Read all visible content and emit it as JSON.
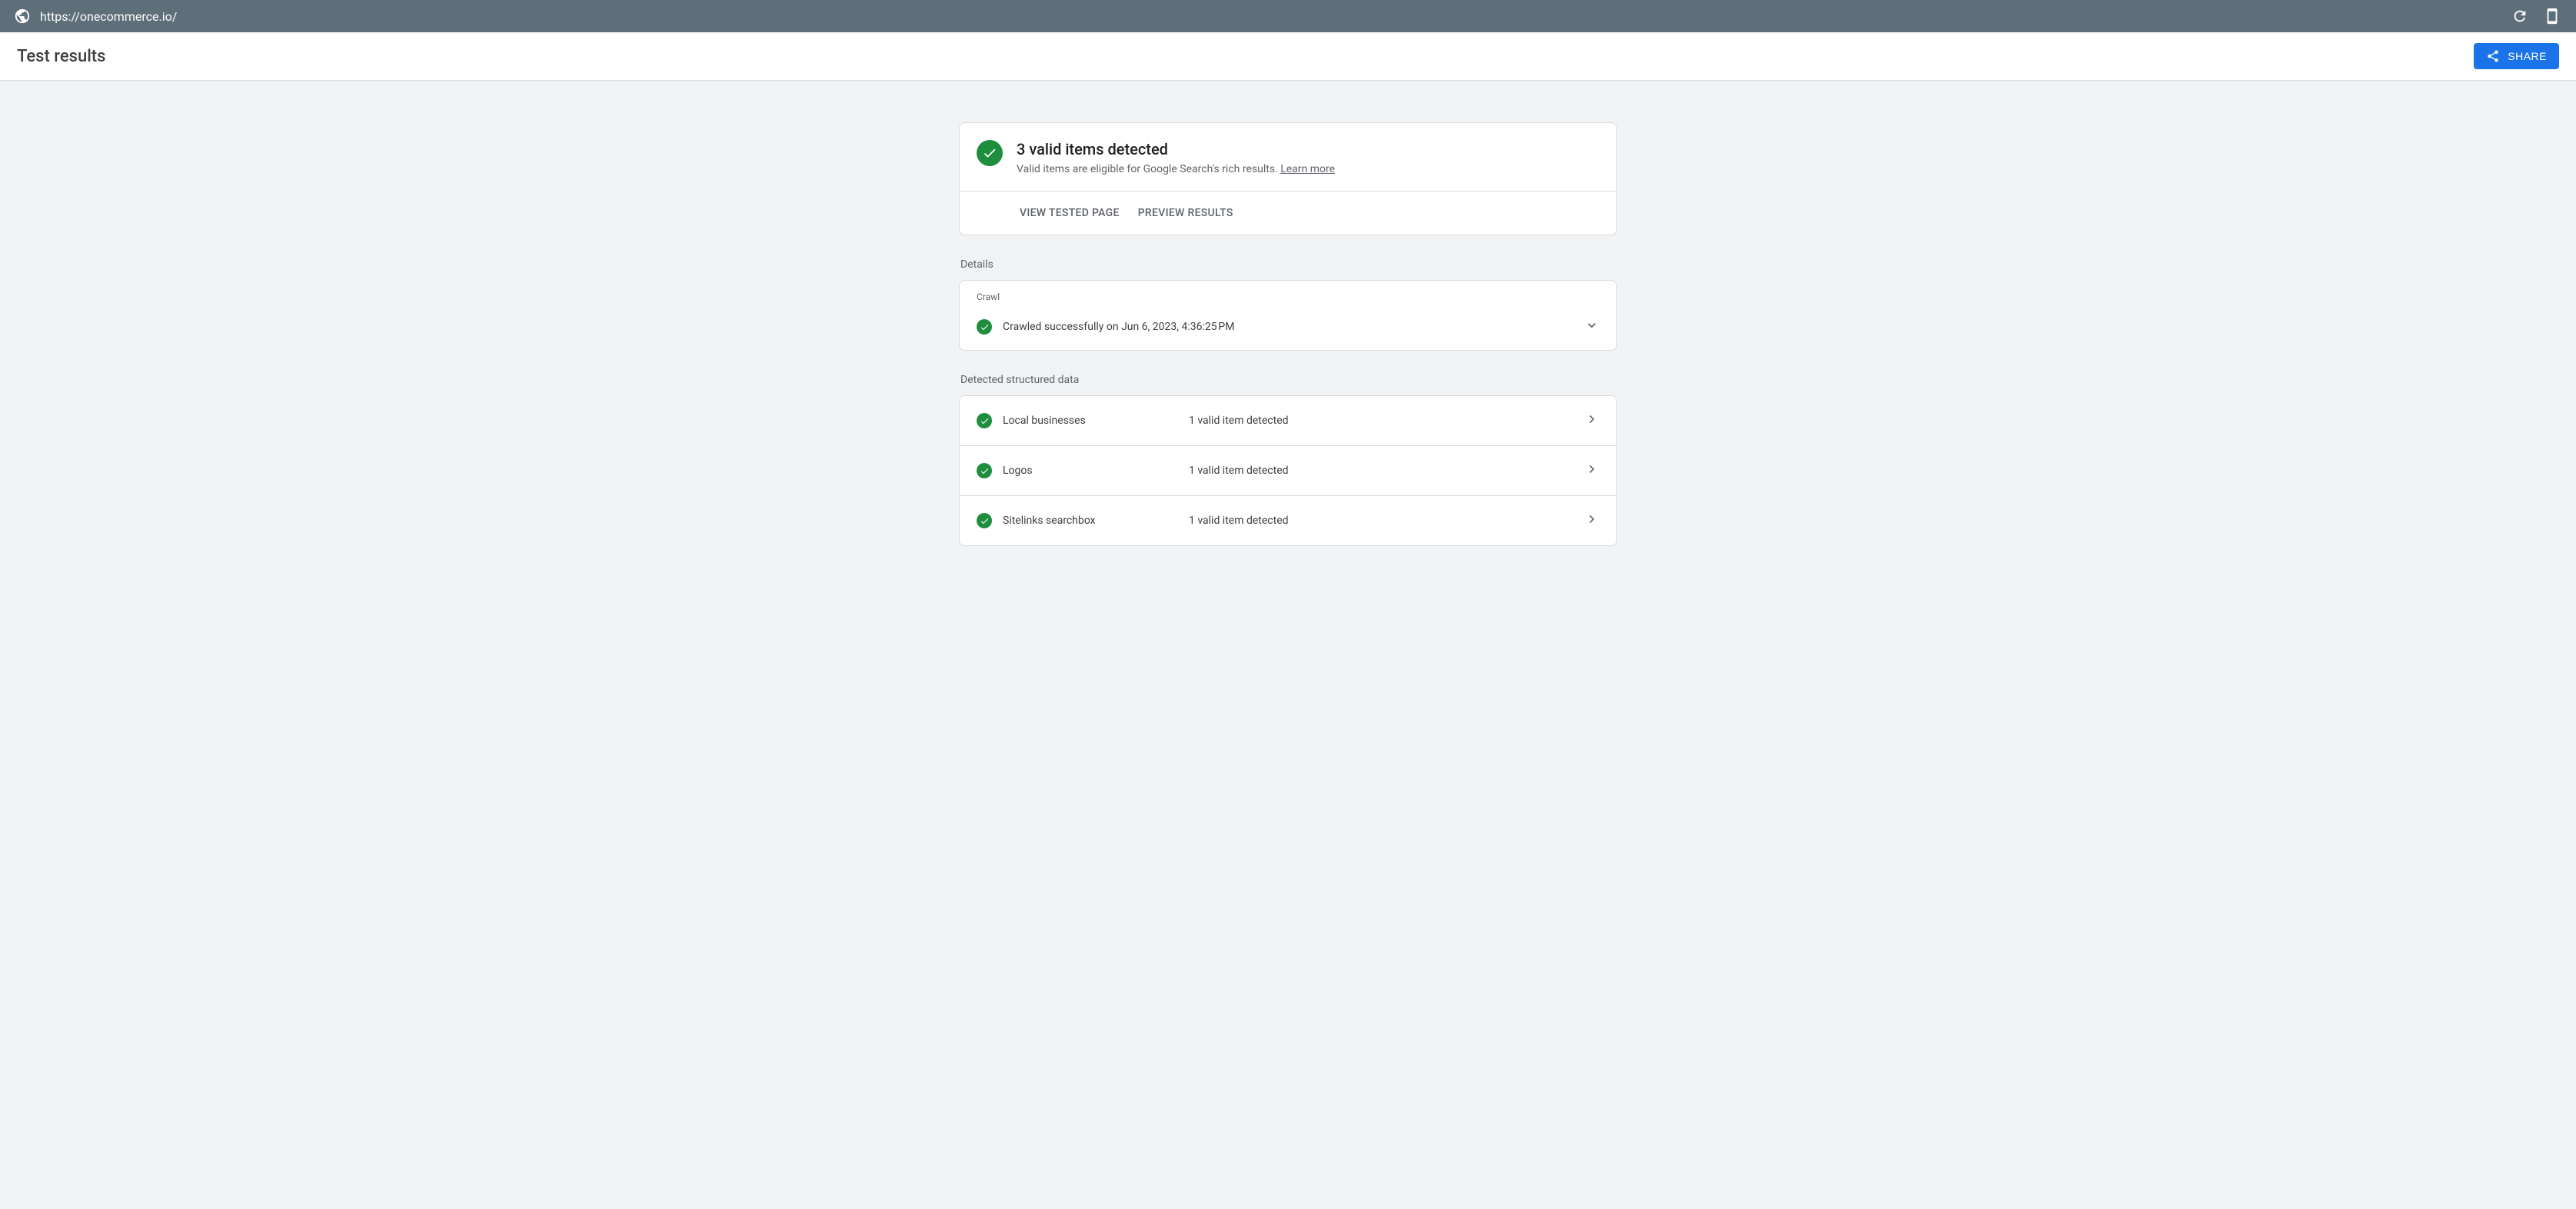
{
  "topbar": {
    "url": "https://onecommerce.io/"
  },
  "header": {
    "title": "Test results",
    "share_label": "SHARE"
  },
  "summary": {
    "title": "3 valid items detected",
    "subtitle_prefix": "Valid items are eligible for Google Search's rich results. ",
    "learn_more": "Learn more",
    "view_tested": "VIEW TESTED PAGE",
    "preview_results": "PREVIEW RESULTS"
  },
  "sections": {
    "details_label": "Details",
    "detected_label": "Detected structured data"
  },
  "crawl": {
    "header": "Crawl",
    "status": "Crawled successfully on Jun 6, 2023, 4:36:25 PM"
  },
  "structured_data": [
    {
      "name": "Local businesses",
      "count": "1 valid item detected"
    },
    {
      "name": "Logos",
      "count": "1 valid item detected"
    },
    {
      "name": "Sitelinks searchbox",
      "count": "1 valid item detected"
    }
  ]
}
